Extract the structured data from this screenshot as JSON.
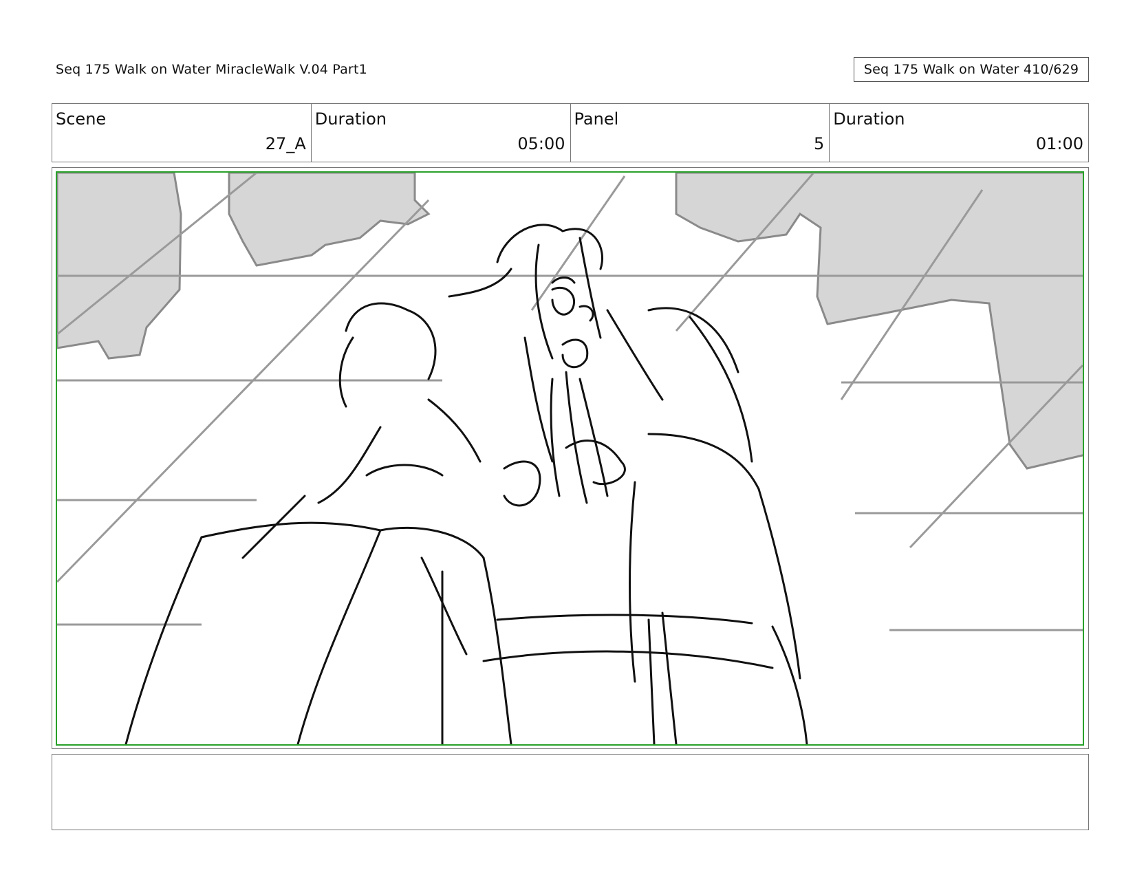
{
  "header": {
    "title": "Seq 175 Walk on Water  MiracleWalk V.04 Part1",
    "page_ref": "Seq 175 Walk on Water 410/629"
  },
  "info": {
    "scene_label": "Scene",
    "scene_value": "27_A",
    "scene_duration_label": "Duration",
    "scene_duration_value": "05:00",
    "panel_label": "Panel",
    "panel_value": "5",
    "panel_duration_label": "Duration",
    "panel_duration_value": "01:00"
  },
  "panel": {
    "border_color": "#2aa12a",
    "sketch_color": "#111111",
    "background_tone": "#d6d6d6"
  },
  "notes": {
    "text": ""
  }
}
